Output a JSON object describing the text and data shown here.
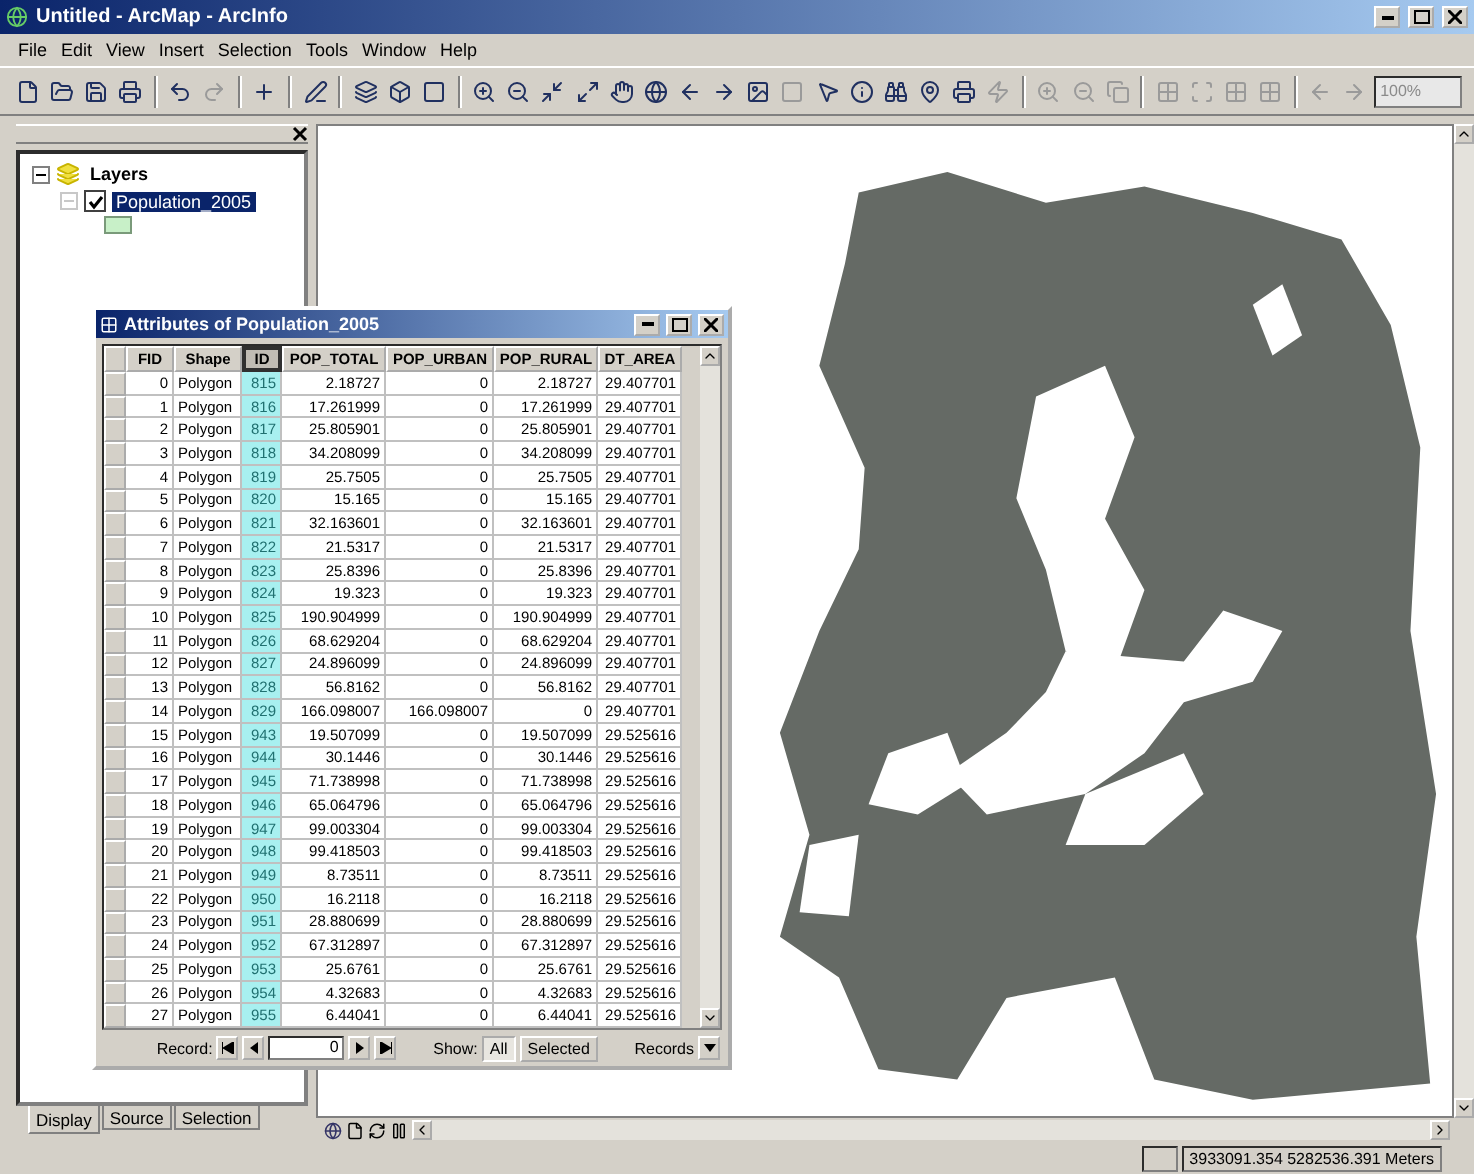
{
  "window": {
    "title": "Untitled - ArcMap - ArcInfo"
  },
  "menu": [
    "File",
    "Edit",
    "View",
    "Insert",
    "Selection",
    "Tools",
    "Window",
    "Help"
  ],
  "toolbar": {
    "zoom_scale": "100%"
  },
  "toc": {
    "root": {
      "label": "Layers",
      "expanded": true,
      "children": [
        {
          "label": "Population_2005",
          "checked": true,
          "selected": true
        }
      ]
    },
    "tabs": [
      {
        "label": "Display",
        "selected": true
      },
      {
        "label": "Source",
        "selected": false
      },
      {
        "label": "Selection",
        "selected": false
      }
    ]
  },
  "attribute_window": {
    "title": "Attributes of Population_2005",
    "columns": [
      {
        "label": "FID",
        "selected": false
      },
      {
        "label": "Shape",
        "selected": false
      },
      {
        "label": "ID",
        "selected": true
      },
      {
        "label": "POP_TOTAL",
        "selected": false
      },
      {
        "label": "POP_URBAN",
        "selected": false
      },
      {
        "label": "POP_RURAL",
        "selected": false
      },
      {
        "label": "DT_AREA",
        "selected": false
      }
    ],
    "rows": [
      [
        "0",
        "Polygon",
        "815",
        "2.18727",
        "0",
        "2.18727",
        "29.407701"
      ],
      [
        "1",
        "Polygon",
        "816",
        "17.261999",
        "0",
        "17.261999",
        "29.407701"
      ],
      [
        "2",
        "Polygon",
        "817",
        "25.805901",
        "0",
        "25.805901",
        "29.407701"
      ],
      [
        "3",
        "Polygon",
        "818",
        "34.208099",
        "0",
        "34.208099",
        "29.407701"
      ],
      [
        "4",
        "Polygon",
        "819",
        "25.7505",
        "0",
        "25.7505",
        "29.407701"
      ],
      [
        "5",
        "Polygon",
        "820",
        "15.165",
        "0",
        "15.165",
        "29.407701"
      ],
      [
        "6",
        "Polygon",
        "821",
        "32.163601",
        "0",
        "32.163601",
        "29.407701"
      ],
      [
        "7",
        "Polygon",
        "822",
        "21.5317",
        "0",
        "21.5317",
        "29.407701"
      ],
      [
        "8",
        "Polygon",
        "823",
        "25.8396",
        "0",
        "25.8396",
        "29.407701"
      ],
      [
        "9",
        "Polygon",
        "824",
        "19.323",
        "0",
        "19.323",
        "29.407701"
      ],
      [
        "10",
        "Polygon",
        "825",
        "190.904999",
        "0",
        "190.904999",
        "29.407701"
      ],
      [
        "11",
        "Polygon",
        "826",
        "68.629204",
        "0",
        "68.629204",
        "29.407701"
      ],
      [
        "12",
        "Polygon",
        "827",
        "24.896099",
        "0",
        "24.896099",
        "29.407701"
      ],
      [
        "13",
        "Polygon",
        "828",
        "56.8162",
        "0",
        "56.8162",
        "29.407701"
      ],
      [
        "14",
        "Polygon",
        "829",
        "166.098007",
        "166.098007",
        "0",
        "29.407701"
      ],
      [
        "15",
        "Polygon",
        "943",
        "19.507099",
        "0",
        "19.507099",
        "29.525616"
      ],
      [
        "16",
        "Polygon",
        "944",
        "30.1446",
        "0",
        "30.1446",
        "29.525616"
      ],
      [
        "17",
        "Polygon",
        "945",
        "71.738998",
        "0",
        "71.738998",
        "29.525616"
      ],
      [
        "18",
        "Polygon",
        "946",
        "65.064796",
        "0",
        "65.064796",
        "29.525616"
      ],
      [
        "19",
        "Polygon",
        "947",
        "99.003304",
        "0",
        "99.003304",
        "29.525616"
      ],
      [
        "20",
        "Polygon",
        "948",
        "99.418503",
        "0",
        "99.418503",
        "29.525616"
      ],
      [
        "21",
        "Polygon",
        "949",
        "8.73511",
        "0",
        "8.73511",
        "29.525616"
      ],
      [
        "22",
        "Polygon",
        "950",
        "16.2118",
        "0",
        "16.2118",
        "29.525616"
      ],
      [
        "23",
        "Polygon",
        "951",
        "28.880699",
        "0",
        "28.880699",
        "29.525616"
      ],
      [
        "24",
        "Polygon",
        "952",
        "67.312897",
        "0",
        "67.312897",
        "29.525616"
      ],
      [
        "25",
        "Polygon",
        "953",
        "25.6761",
        "0",
        "25.6761",
        "29.525616"
      ],
      [
        "26",
        "Polygon",
        "954",
        "4.32683",
        "0",
        "4.32683",
        "29.525616"
      ],
      [
        "27",
        "Polygon",
        "955",
        "6.44041",
        "0",
        "6.44041",
        "29.525616"
      ]
    ],
    "footer": {
      "record_label": "Record:",
      "record_value": "0",
      "show_label": "Show:",
      "show_buttons": [
        {
          "label": "All",
          "selected": true
        },
        {
          "label": "Selected",
          "selected": false
        }
      ],
      "options": "Records"
    }
  },
  "status_bar": {
    "coordinates": "3933091.354  5282536.391 Meters"
  }
}
